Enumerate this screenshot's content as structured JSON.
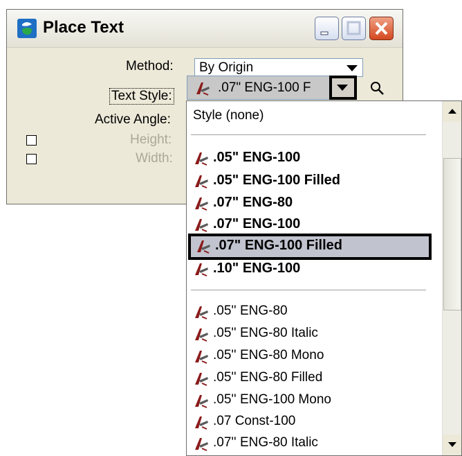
{
  "window": {
    "title": "Place Text",
    "buttons": {
      "minimize": "minimize",
      "maximize": "maximize",
      "close": "close"
    }
  },
  "form": {
    "method_label": "Method:",
    "method_value": "By Origin",
    "text_style_label": "Text Style:",
    "text_style_value": ".07\"  ENG-100 F",
    "active_angle_label": "Active Angle:",
    "height_label": "Height:",
    "width_label": "Width:"
  },
  "dropdown": {
    "none_item": "Style (none)",
    "group1": [
      ".05\"  ENG-100",
      ".05\"  ENG-100 Filled",
      ".07\"  ENG-80",
      ".07\"  ENG-100",
      ".07\"  ENG-100 Filled",
      ".10\"  ENG-100"
    ],
    "selected_index": 4,
    "group2": [
      ".05'' ENG-80",
      ".05'' ENG-80  Italic",
      ".05'' ENG-80  Mono",
      ".05'' ENG-80 Filled",
      ".05'' ENG-100  Mono",
      ".07 Const-100",
      ".07'' ENG-80  Italic"
    ]
  },
  "icons": {
    "app": "microstation-logo-icon",
    "style": "text-style-icon",
    "lookup": "magnifier-icon"
  },
  "colors": {
    "highlight": "#c1c4cf",
    "close_button": "#d3481f",
    "dialog_bg": "#ece9d8"
  }
}
